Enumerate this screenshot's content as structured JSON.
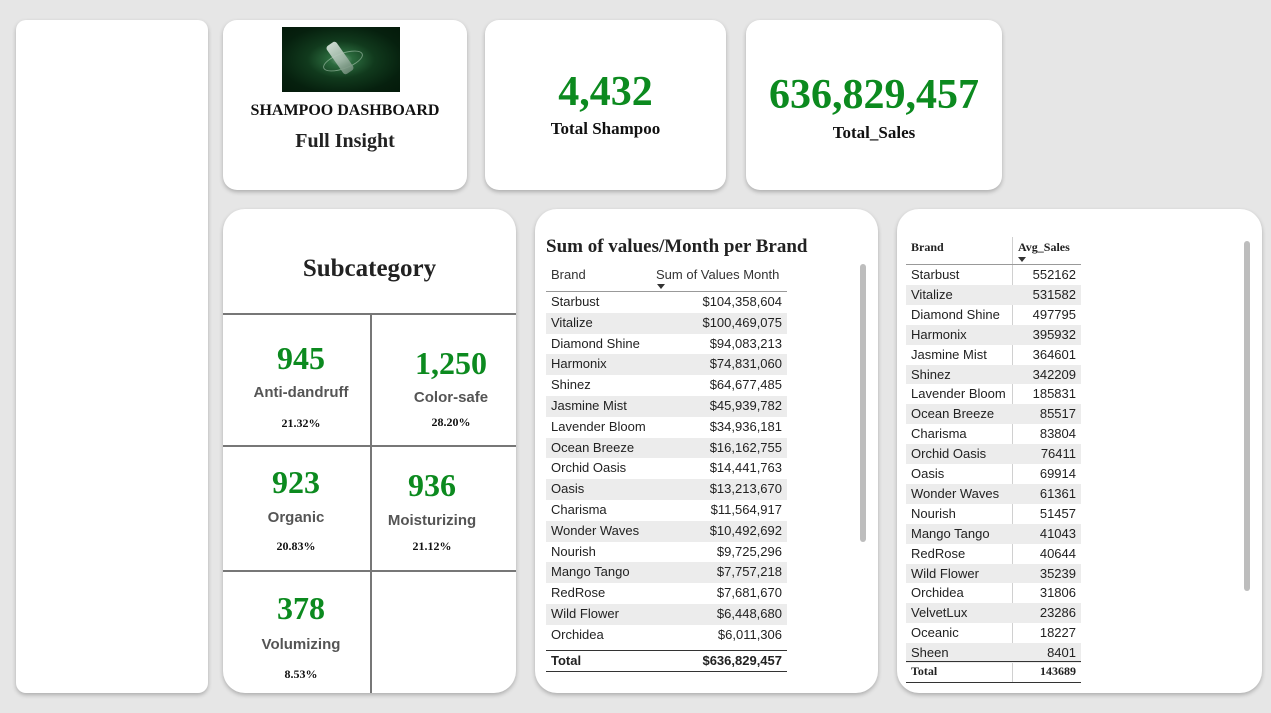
{
  "header": {
    "dashboard_title": "SHAMPOO DASHBOARD",
    "dashboard_subtitle": "Full Insight"
  },
  "kpis": {
    "total_shampoo": {
      "value": "4,432",
      "label": "Total Shampoo"
    },
    "total_sales": {
      "value": "636,829,457",
      "label": "Total_Sales"
    }
  },
  "subcategory": {
    "title": "Subcategory",
    "items": [
      {
        "count": "945",
        "name": "Anti-dandruff",
        "pct": "21.32%"
      },
      {
        "count": "1,250",
        "name": "Color-safe",
        "pct": "28.20%"
      },
      {
        "count": "923",
        "name": "Organic",
        "pct": "20.83%"
      },
      {
        "count": "936",
        "name": "Moisturizing",
        "pct": "21.12%"
      },
      {
        "count": "378",
        "name": "Volumizing",
        "pct": "8.53%"
      }
    ]
  },
  "brand_sum_table": {
    "title": "Sum of values/Month per Brand",
    "col_brand": "Brand",
    "col_value": "Sum of Values Month",
    "rows": [
      [
        "Starbust",
        "$104,358,604"
      ],
      [
        "Vitalize",
        "$100,469,075"
      ],
      [
        "Diamond Shine",
        "$94,083,213"
      ],
      [
        "Harmonix",
        "$74,831,060"
      ],
      [
        "Shinez",
        "$64,677,485"
      ],
      [
        "Jasmine Mist",
        "$45,939,782"
      ],
      [
        "Lavender Bloom",
        "$34,936,181"
      ],
      [
        "Ocean Breeze",
        "$16,162,755"
      ],
      [
        "Orchid Oasis",
        "$14,441,763"
      ],
      [
        "Oasis",
        "$13,213,670"
      ],
      [
        "Charisma",
        "$11,564,917"
      ],
      [
        "Wonder Waves",
        "$10,492,692"
      ],
      [
        "Nourish",
        "$9,725,296"
      ],
      [
        "Mango Tango",
        "$7,757,218"
      ],
      [
        "RedRose",
        "$7,681,670"
      ],
      [
        "Wild Flower",
        "$6,448,680"
      ],
      [
        "Orchidea",
        "$6,011,306"
      ]
    ],
    "total_label": "Total",
    "total_value": "$636,829,457"
  },
  "avg_sales_table": {
    "col_brand": "Brand",
    "col_value": "Avg_Sales",
    "rows": [
      [
        "Starbust",
        "552162"
      ],
      [
        "Vitalize",
        "531582"
      ],
      [
        "Diamond Shine",
        "497795"
      ],
      [
        "Harmonix",
        "395932"
      ],
      [
        "Jasmine Mist",
        "364601"
      ],
      [
        "Shinez",
        "342209"
      ],
      [
        "Lavender Bloom",
        "185831"
      ],
      [
        "Ocean Breeze",
        "85517"
      ],
      [
        "Charisma",
        "83804"
      ],
      [
        "Orchid Oasis",
        "76411"
      ],
      [
        "Oasis",
        "69914"
      ],
      [
        "Wonder Waves",
        "61361"
      ],
      [
        "Nourish",
        "51457"
      ],
      [
        "Mango Tango",
        "41043"
      ],
      [
        "RedRose",
        "40644"
      ],
      [
        "Wild Flower",
        "35239"
      ],
      [
        "Orchidea",
        "31806"
      ],
      [
        "VelvetLux",
        "23286"
      ],
      [
        "Oceanic",
        "18227"
      ],
      [
        "Sheen",
        "8401"
      ]
    ],
    "total_label": "Total",
    "total_value": "143689"
  },
  "colors": {
    "kpi_green": "#0c8a1f",
    "background": "#e6e6e6"
  }
}
